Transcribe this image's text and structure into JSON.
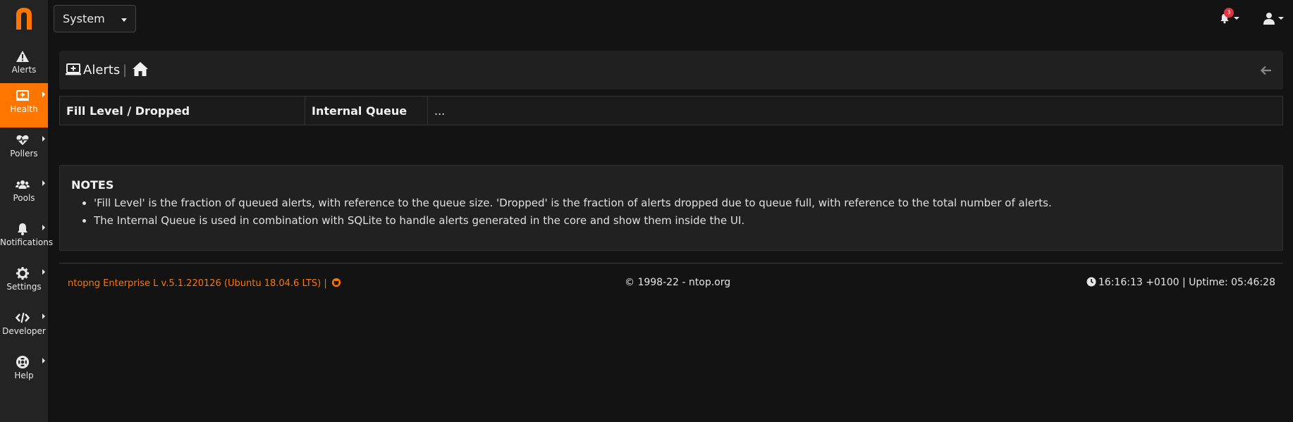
{
  "sidebar": {
    "logo_letter": "n",
    "items": [
      {
        "label": "Alerts",
        "icon": "warning-icon",
        "active": false,
        "has_caret": false
      },
      {
        "label": "Health",
        "icon": "monitor-heartbeat-icon",
        "active": true,
        "has_caret": true
      },
      {
        "label": "Pollers",
        "icon": "heart-pulse-icon",
        "active": false,
        "has_caret": true
      },
      {
        "label": "Pools",
        "icon": "users-icon",
        "active": false,
        "has_caret": true
      },
      {
        "label": "Notifications",
        "icon": "bell-icon",
        "active": false,
        "has_caret": true
      },
      {
        "label": "Settings",
        "icon": "gear-icon",
        "active": false,
        "has_caret": true
      },
      {
        "label": "Developer",
        "icon": "code-icon",
        "active": false,
        "has_caret": true
      },
      {
        "label": "Help",
        "icon": "lifebuoy-icon",
        "active": false,
        "has_caret": true
      }
    ],
    "accent": "#ff7500"
  },
  "topbar": {
    "interface_select": "System",
    "notification_count": "3"
  },
  "header": {
    "title": "Alerts",
    "separator": "|"
  },
  "table": {
    "col1": "Fill Level / Dropped",
    "col2": "Internal Queue",
    "col3": "..."
  },
  "notes": {
    "title": "NOTES",
    "items": [
      "'Fill Level' is the fraction of queued alerts, with reference to the queue size. 'Dropped' is the fraction of alerts dropped due to queue full, with reference to the total number of alerts.",
      "The Internal Queue is used in combination with SQLite to handle alerts generated in the core and show them inside the UI."
    ]
  },
  "footer": {
    "version": "ntopng Enterprise L v.5.1.220126 (Ubuntu 18.04.6 LTS) |",
    "copyright": "© 1998-22 - ntop.org",
    "status": "16:16:13 +0100 | Uptime: 05:46:28"
  }
}
